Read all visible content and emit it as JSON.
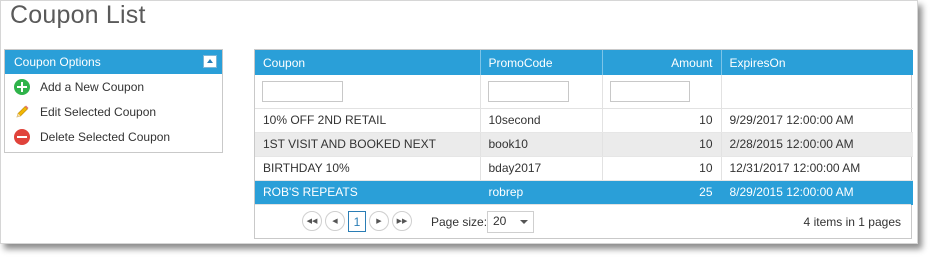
{
  "page": {
    "title": "Coupon List"
  },
  "options": {
    "header": "Coupon Options",
    "items": [
      {
        "label": "Add a New Coupon",
        "icon": "add-circle-icon"
      },
      {
        "label": "Edit Selected Coupon",
        "icon": "pencil-icon"
      },
      {
        "label": "Delete Selected Coupon",
        "icon": "delete-circle-icon"
      }
    ]
  },
  "grid": {
    "columns": [
      "Coupon",
      "PromoCode",
      "Amount",
      "ExpiresOn"
    ],
    "filters": {
      "coupon": "",
      "promocode": "",
      "amount": ""
    },
    "rows": [
      {
        "coupon": "10% OFF 2ND RETAIL",
        "promocode": "10second",
        "amount": "10",
        "expires": "9/29/2017 12:00:00 AM"
      },
      {
        "coupon": "1ST VISIT AND BOOKED NEXT",
        "promocode": "book10",
        "amount": "10",
        "expires": "2/28/2015 12:00:00 AM"
      },
      {
        "coupon": "BIRTHDAY 10%",
        "promocode": "bday2017",
        "amount": "10",
        "expires": "12/31/2017 12:00:00 AM"
      },
      {
        "coupon": "ROB'S REPEATS",
        "promocode": "robrep",
        "amount": "25",
        "expires": "8/29/2015 12:00:00 AM"
      }
    ],
    "selected_row": 3
  },
  "pager": {
    "current_page": "1",
    "page_size_label": "Page size:",
    "page_size": "20",
    "items_count": "4",
    "items_text": "items in",
    "pages_count": "1",
    "pages_text": "pages"
  },
  "colors": {
    "accent": "#2a9fd8",
    "alt_row": "#ebebeb",
    "add": "#2fb34a",
    "delete": "#e0433b"
  }
}
